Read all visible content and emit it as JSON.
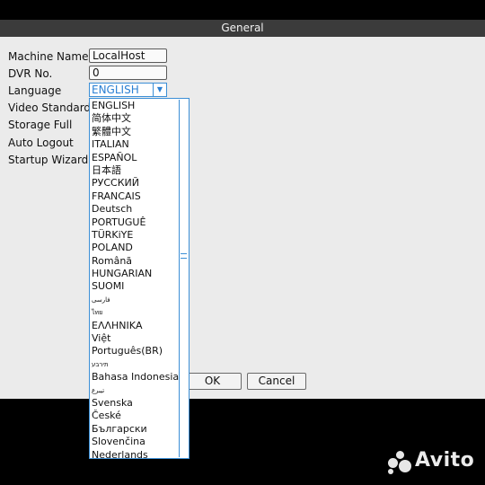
{
  "window": {
    "title": "General"
  },
  "form": {
    "labels": {
      "machine_name": "Machine Name",
      "dvr_no": "DVR No.",
      "language": "Language",
      "video_standard": "Video Standard",
      "storage_full": "Storage Full",
      "auto_logout": "Auto Logout",
      "startup_wizard": "Startup Wizard"
    },
    "machine_name_value": "LocalHost",
    "dvr_no_value": "0",
    "language_selected": "ENGLISH"
  },
  "language_options": [
    "ENGLISH",
    "简体中文",
    "繁體中文",
    "ITALIAN",
    "ESPAÑOL",
    "日本語",
    "РУССКИЙ",
    "FRANCAIS",
    "Deutsch",
    "PORTUGUÊ",
    "TÜRKiYE",
    "POLAND",
    "Românã",
    "HUNGARIAN",
    "SUOMI",
    "فارسی",
    "ไทย",
    "ΕΛΛΗΝΙΚΑ",
    "Việt",
    "Português(BR)",
    "תירבע",
    "Bahasa Indonesia",
    "تيبرع",
    "Svenska",
    "České",
    "Български",
    "Slovenčina",
    "Nederlands"
  ],
  "buttons": {
    "ok": "OK",
    "cancel": "Cancel"
  },
  "watermark": {
    "text": "Avito"
  },
  "colors": {
    "accent": "#3c8fd6",
    "titlebar": "#3b3b3b",
    "dialog_bg": "#ebebeb"
  }
}
